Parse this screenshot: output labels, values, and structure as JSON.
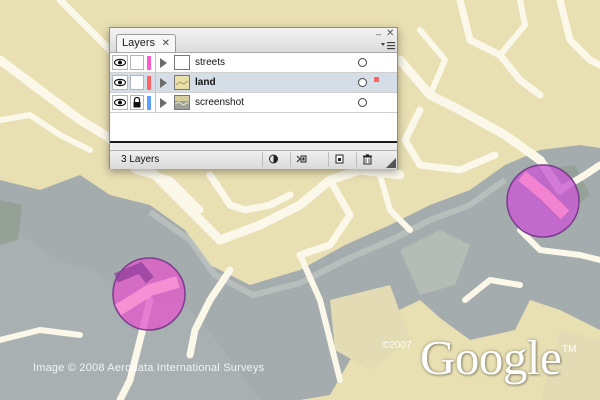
{
  "panel": {
    "tab_label": "Layers",
    "tab_close_glyph": "✕",
    "minimize_glyph": "–",
    "close_glyph": "✕",
    "layers": [
      {
        "name": "streets",
        "color": "#ff5ad0",
        "locked": false,
        "visible": true,
        "selected": false
      },
      {
        "name": "land",
        "color": "#ff6464",
        "locked": false,
        "visible": true,
        "selected": true
      },
      {
        "name": "screenshot",
        "color": "#5aa0ff",
        "locked": true,
        "visible": true,
        "selected": false
      }
    ],
    "footer_count": "3 Layers",
    "icons": [
      "eye-icon",
      "lock-icon",
      "expand-triangle-icon",
      "make-clipping-mask-icon",
      "new-sublayer-icon",
      "new-layer-icon",
      "delete-layer-icon",
      "panel-menu-icon"
    ]
  },
  "map": {
    "credit_text": "Image © 2008 Aerodata International Surveys",
    "copyright": "©2007",
    "logo_text": "Google",
    "logo_tm": "TM",
    "highlight_color": "#e05ac8"
  }
}
